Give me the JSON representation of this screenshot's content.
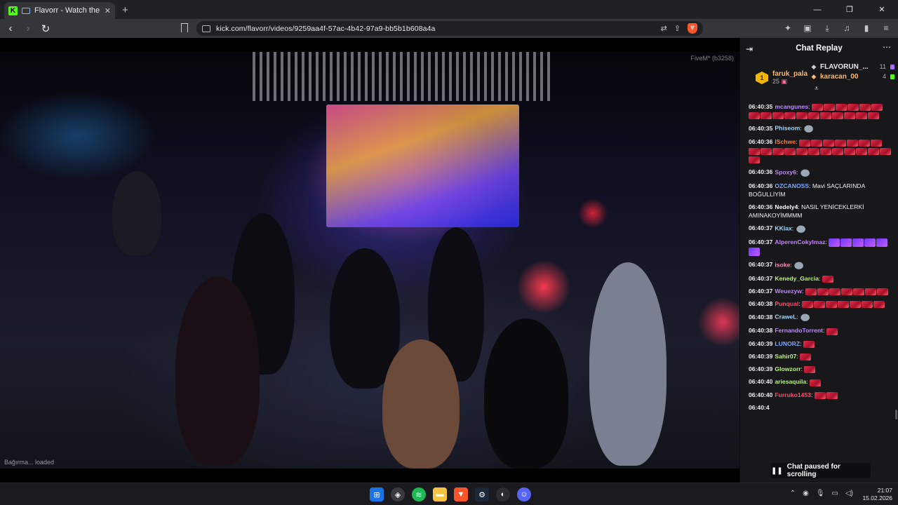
{
  "browser": {
    "tab_title": "Flavorr - Watch the VOD on K",
    "url": "kick.com/flavorr/videos/9259aa4f-57ac-4b42-97a9-bb5b1b608a4a"
  },
  "video": {
    "watermark": "FiveM* (b3258)",
    "loaded_text": "Bağırma... loaded"
  },
  "chat": {
    "title": "Chat Replay",
    "leaderboard": {
      "first": {
        "rank": "1",
        "name": "faruk_pala",
        "count": "25"
      },
      "others": [
        {
          "name": "FLAVORUN_...",
          "count": "11",
          "name_color": "#ffffff",
          "sq_color": "#a970ff"
        },
        {
          "name": "karacan_00",
          "count": "4",
          "name_color": "#ffb86b",
          "sq_color": "#53fc18"
        }
      ]
    },
    "messages": [
      {
        "time": "06:40:35",
        "user": "mcangunes",
        "color": "#b98cff",
        "text": "",
        "emote": "red",
        "count": 17
      },
      {
        "time": "06:40:35",
        "user": "Phiseom",
        "color": "#9fd8ff",
        "text": "",
        "emote": "rat",
        "count": 1
      },
      {
        "time": "06:40:36",
        "user": "ISchwe",
        "color": "#ff7a3d",
        "text": "",
        "emote": "red",
        "count": 20
      },
      {
        "time": "06:40:36",
        "user": "Spoxy6",
        "color": "#c084fc",
        "text": "",
        "emote": "rat",
        "count": 1
      },
      {
        "time": "06:40:36",
        "user": "OZCANOSS",
        "color": "#7aa8ff",
        "text": "Mavi SAÇLARINDA BOĞULLİYİM",
        "emote": "",
        "count": 0
      },
      {
        "time": "06:40:36",
        "user": "Nedely4",
        "color": "#ffffff",
        "text": "NASIL YENİCEKLERKİ AMINAKOYİMMMM",
        "emote": "",
        "count": 0
      },
      {
        "time": "06:40:37",
        "user": "KKlax",
        "color": "#9fd8ff",
        "text": "",
        "emote": "rat",
        "count": 1
      },
      {
        "time": "06:40:37",
        "user": "AlperenCokylmaz",
        "color": "#c084fc",
        "text": "",
        "emote": "purple",
        "count": 6
      },
      {
        "time": "06:40:37",
        "user": "isoke",
        "color": "#ff8fb1",
        "text": "",
        "emote": "rat",
        "count": 1
      },
      {
        "time": "06:40:37",
        "user": "Kenedy_Garcia",
        "color": "#b9f27c",
        "text": "",
        "emote": "red",
        "count": 1
      },
      {
        "time": "06:40:37",
        "user": "Weuezyw",
        "color": "#c084fc",
        "text": "",
        "emote": "red",
        "count": 7
      },
      {
        "time": "06:40:38",
        "user": "Punqual",
        "color": "#ff4d6d",
        "text": "",
        "emote": "red",
        "count": 7
      },
      {
        "time": "06:40:38",
        "user": "CraweL",
        "color": "#9fd8ff",
        "text": "",
        "emote": "rat",
        "count": 1
      },
      {
        "time": "06:40:38",
        "user": "FernandoTorrent",
        "color": "#b98cff",
        "text": "",
        "emote": "red",
        "count": 1
      },
      {
        "time": "06:40:39",
        "user": "LUNORZ",
        "color": "#7aa8ff",
        "text": "",
        "emote": "red",
        "count": 1
      },
      {
        "time": "06:40:39",
        "user": "Sahir07",
        "color": "#b9f27c",
        "text": "",
        "emote": "red",
        "count": 1
      },
      {
        "time": "06:40:39",
        "user": "Glowzorr",
        "color": "#b9f27c",
        "text": "",
        "emote": "red",
        "count": 1
      },
      {
        "time": "06:40:40",
        "user": "ariesaquila",
        "color": "#b9f27c",
        "text": "",
        "emote": "red",
        "count": 1
      },
      {
        "time": "06:40:40",
        "user": "Furruko1453",
        "color": "#ff4d6d",
        "text": "",
        "emote": "red",
        "count": 2
      }
    ],
    "last_time_partial": "06:40:4",
    "paused_label": "Chat paused for scrolling"
  },
  "taskbar": {
    "time": "21:07",
    "date": "15.02.2026"
  }
}
